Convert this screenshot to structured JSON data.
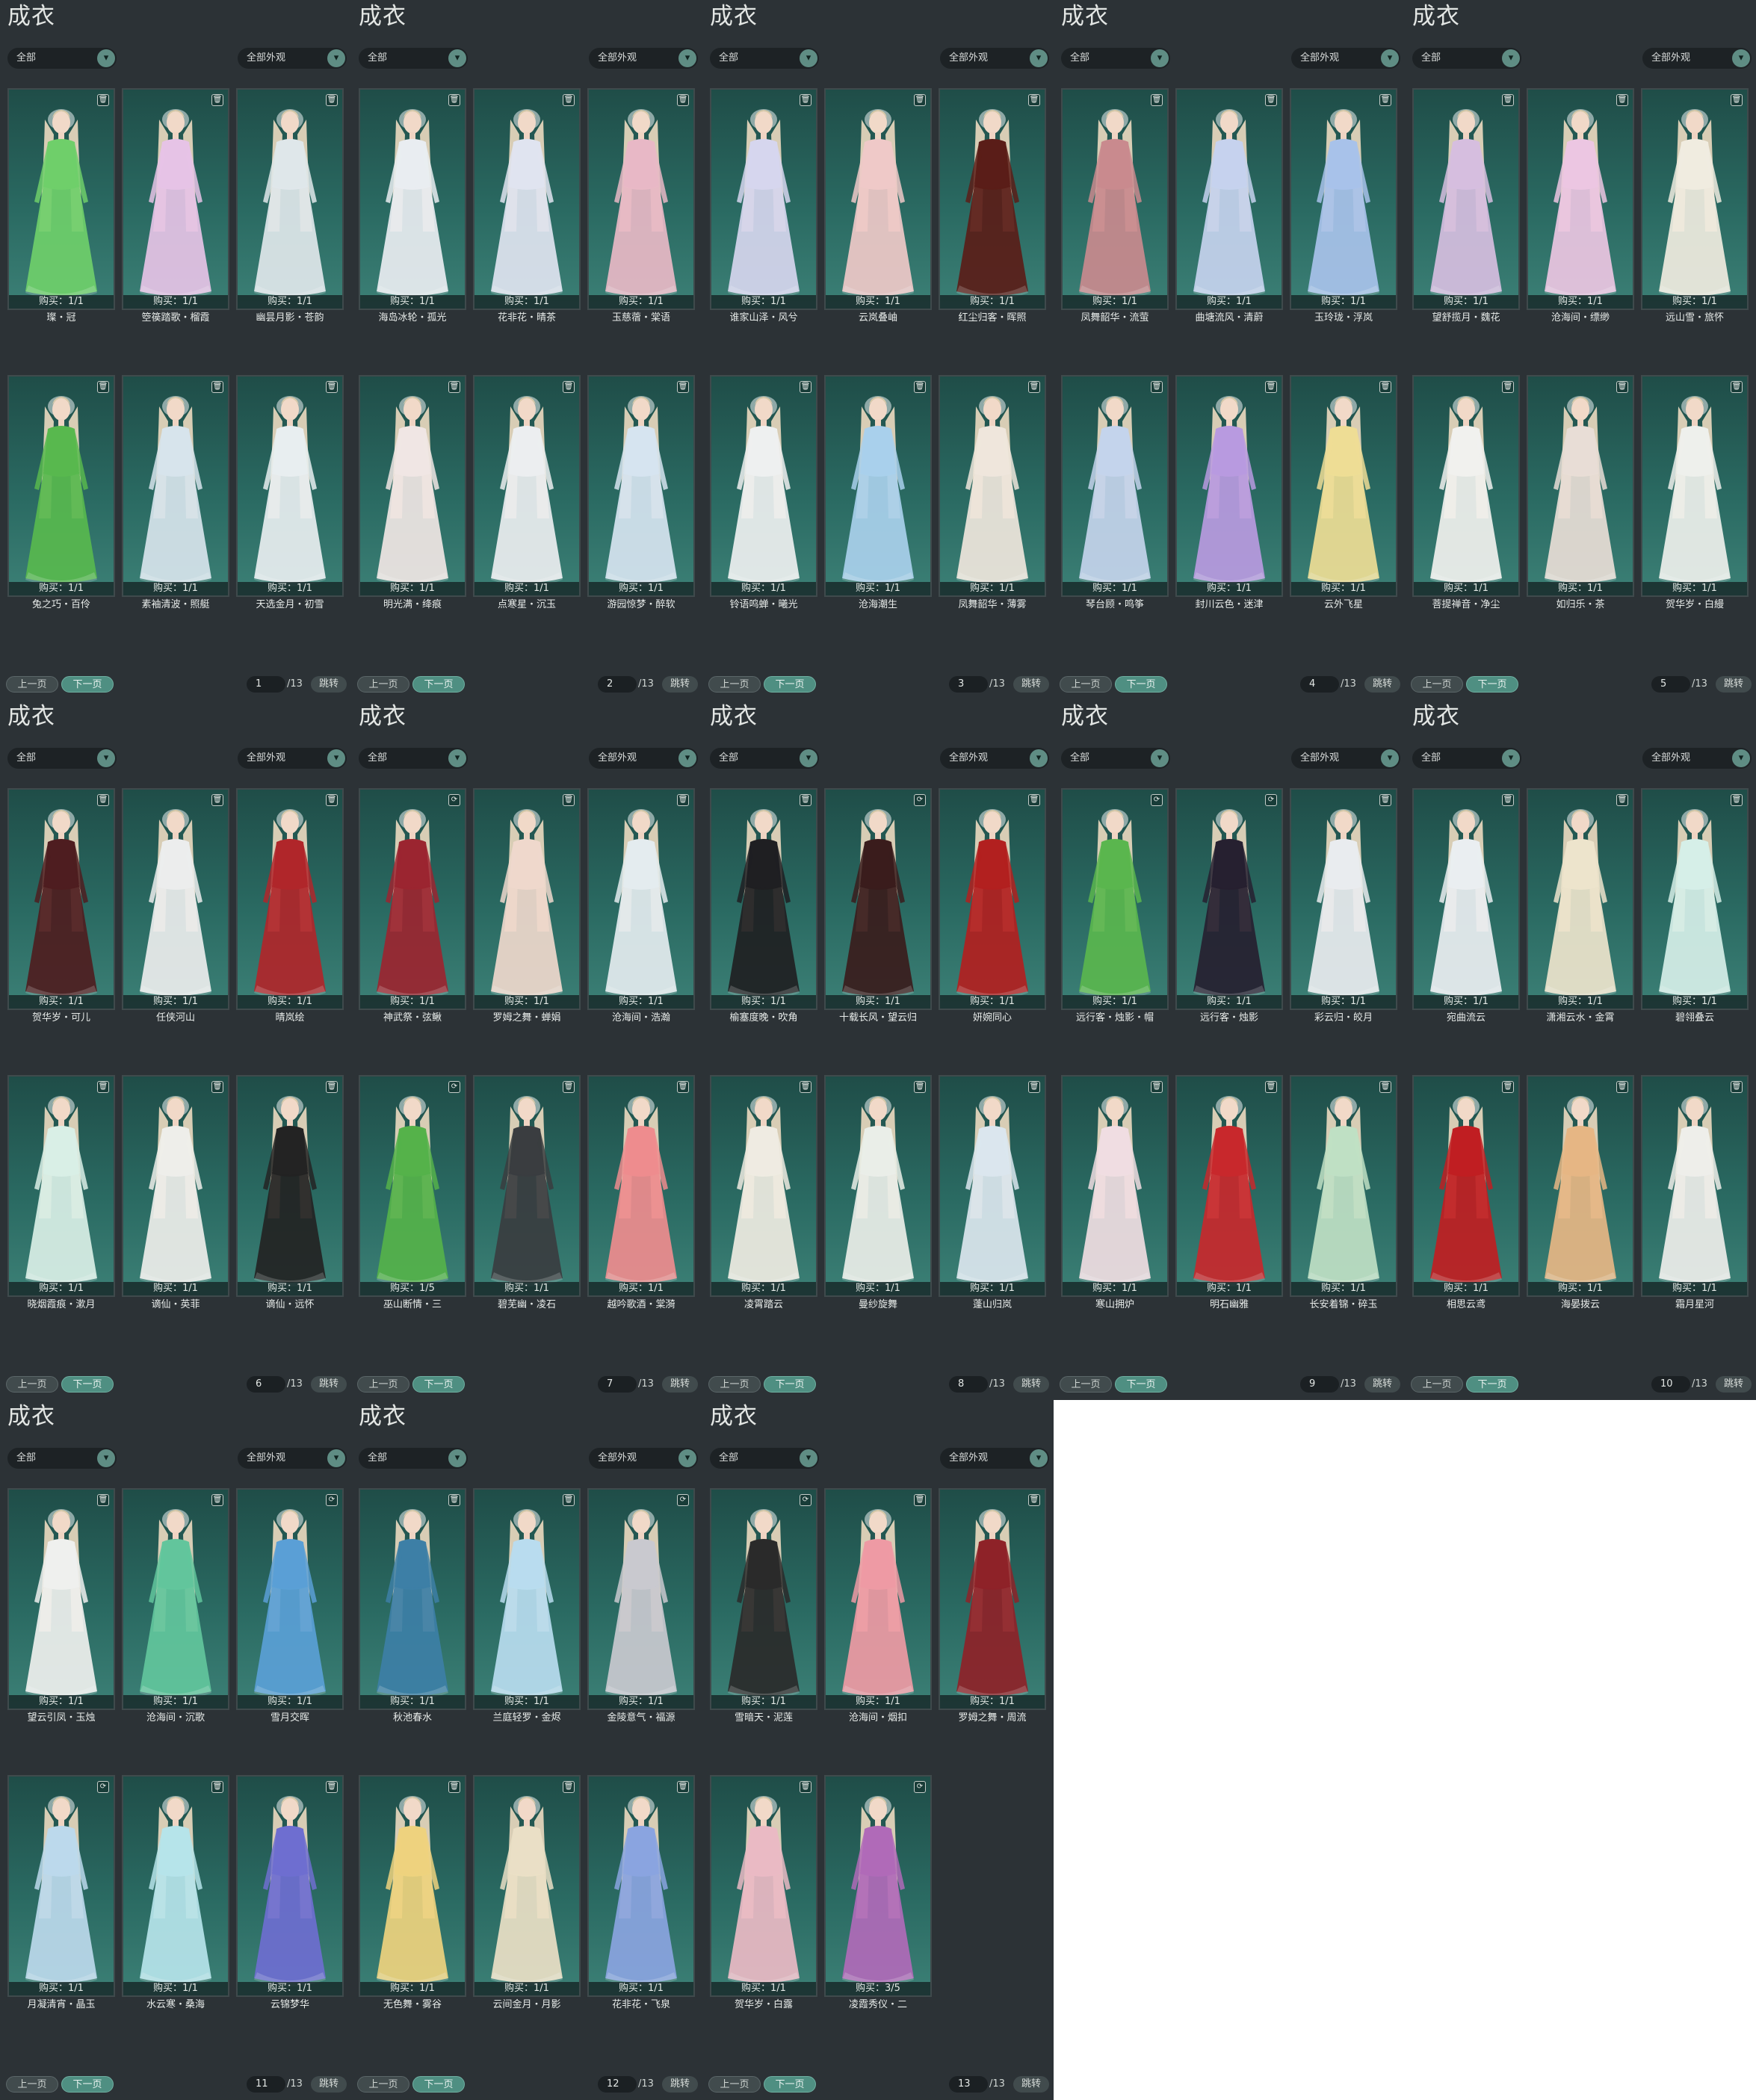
{
  "panel_title": "成衣",
  "filter_left": "全部",
  "filter_right": "全部外观",
  "prev_label": "上一页",
  "next_label": "下一页",
  "jump_label": "跳转",
  "total_pages": "/13",
  "colors": {
    "accent": "#5f8d84",
    "panel_bg": "#2c3236",
    "card_bg": "#2a6a62"
  },
  "icons": {
    "select_chevron": "chevron-down-icon",
    "trash": "trash-icon",
    "refresh": "refresh-icon"
  },
  "pages": [
    {
      "page": "1",
      "items": [
        {
          "name": "璨・冠",
          "buy": "购买：1/1",
          "icon": "trash",
          "dress": "#6fcf6a"
        },
        {
          "name": "箜篌踏歌・榴霞",
          "buy": "购买：1/1",
          "icon": "trash",
          "dress": "#e6c3e6"
        },
        {
          "name": "幽昙月影・苍韵",
          "buy": "购买：1/1",
          "icon": "trash",
          "dress": "#dfe7ea"
        },
        {
          "name": "兔之巧・百伶",
          "buy": "购买：1/1",
          "icon": "trash",
          "dress": "#58b84e"
        },
        {
          "name": "素袖清波・照艇",
          "buy": "购买：1/1",
          "icon": "trash",
          "dress": "#d7e4ec"
        },
        {
          "name": "天选金月・初雪",
          "buy": "购买：1/1",
          "icon": "trash",
          "dress": "#e8eef0"
        }
      ]
    },
    {
      "page": "2",
      "items": [
        {
          "name": "海岛冰轮・孤光",
          "buy": "购买：1/1",
          "icon": "trash",
          "dress": "#e9edf1"
        },
        {
          "name": "花非花・晴茶",
          "buy": "购买：1/1",
          "icon": "trash",
          "dress": "#e0e4f0"
        },
        {
          "name": "玉慈蓿・棠语",
          "buy": "购买：1/1",
          "icon": "trash",
          "dress": "#e8b8c6"
        },
        {
          "name": "明光满・绛痕",
          "buy": "购买：1/1",
          "icon": "trash",
          "dress": "#f0e6e4"
        },
        {
          "name": "点寒星・沉玉",
          "buy": "购买：1/1",
          "icon": "trash",
          "dress": "#eceef0"
        },
        {
          "name": "游园惊梦・醉软",
          "buy": "购买：1/1",
          "icon": "trash",
          "dress": "#d6e4f0"
        }
      ]
    },
    {
      "page": "3",
      "items": [
        {
          "name": "谁家山泽・风兮",
          "buy": "购买：1/1",
          "icon": "trash",
          "dress": "#d6d6ee"
        },
        {
          "name": "云岚叠岫",
          "buy": "购买：1/1",
          "icon": "trash",
          "dress": "#efc9c8"
        },
        {
          "name": "红尘归客・晖照",
          "buy": "购买：1/1",
          "icon": "trash",
          "dress": "#5a1d18"
        },
        {
          "name": "铃语鸣蝉・曦光",
          "buy": "购买：1/1",
          "icon": "trash",
          "dress": "#eef0f0"
        },
        {
          "name": "沧海潮生",
          "buy": "购买：1/1",
          "icon": "trash",
          "dress": "#a9d0ec"
        },
        {
          "name": "凤舞韶华・薄雾",
          "buy": "购买：1/1",
          "icon": "trash",
          "dress": "#efe6dc"
        }
      ]
    },
    {
      "page": "4",
      "items": [
        {
          "name": "凤舞韶华・流萤",
          "buy": "购买：1/1",
          "icon": "trash",
          "dress": "#c98a8e"
        },
        {
          "name": "曲塘流风・清蔚",
          "buy": "购买：1/1",
          "icon": "trash",
          "dress": "#c6d2ee"
        },
        {
          "name": "玉玲珑・浮岚",
          "buy": "购买：1/1",
          "icon": "trash",
          "dress": "#a8c2ea"
        },
        {
          "name": "琴台顾・鸣筝",
          "buy": "购买：1/1",
          "icon": "trash",
          "dress": "#c4d4ec"
        },
        {
          "name": "封川云色・迷津",
          "buy": "购买：1/1",
          "icon": "trash",
          "dress": "#b89ae0"
        },
        {
          "name": "云外飞星",
          "buy": "购买：1/1",
          "icon": "trash",
          "dress": "#eedd95"
        }
      ]
    },
    {
      "page": "5",
      "items": [
        {
          "name": "望舒揽月・魏花",
          "buy": "购买：1/1",
          "icon": "trash",
          "dress": "#d6bedf"
        },
        {
          "name": "沧海间・缥缈",
          "buy": "购买：1/1",
          "icon": "trash",
          "dress": "#ecc6e2"
        },
        {
          "name": "远山雪・旅怀",
          "buy": "购买：1/1",
          "icon": "trash",
          "dress": "#f0ece0"
        },
        {
          "name": "菩提禅音・净尘",
          "buy": "购买：1/1",
          "icon": "trash",
          "dress": "#f1f1ee"
        },
        {
          "name": "如归乐・茶",
          "buy": "购买：1/1",
          "icon": "trash",
          "dress": "#e8ddd6"
        },
        {
          "name": "贺华岁・白縵",
          "buy": "购买：1/1",
          "icon": "trash",
          "dress": "#eef0ec"
        }
      ]
    },
    {
      "page": "6",
      "items": [
        {
          "name": "贺华岁・可儿",
          "buy": "购买：1/1",
          "icon": "trash",
          "dress": "#4e1d20"
        },
        {
          "name": "任侠河山",
          "buy": "购买：1/1",
          "icon": "trash",
          "dress": "#eceded"
        },
        {
          "name": "晴岚绘",
          "buy": "购买：1/1",
          "icon": "trash",
          "dress": "#b0262a"
        },
        {
          "name": "晓烟霞痕・漱月",
          "buy": "购买：1/1",
          "icon": "trash",
          "dress": "#d9efe6"
        },
        {
          "name": "谪仙・英菲",
          "buy": "购买：1/1",
          "icon": "trash",
          "dress": "#eeeeea"
        },
        {
          "name": "谪仙・远怀",
          "buy": "购买：1/1",
          "icon": "trash",
          "dress": "#232323"
        }
      ]
    },
    {
      "page": "7",
      "items": [
        {
          "name": "神武祭・弦鳅",
          "buy": "购买：1/1",
          "icon": "refresh",
          "dress": "#9b2530"
        },
        {
          "name": "罗姆之舞・蝉娟",
          "buy": "购买：1/1",
          "icon": "trash",
          "dress": "#efd8cc"
        },
        {
          "name": "沧海间・浩瀚",
          "buy": "购买：1/1",
          "icon": "trash",
          "dress": "#e4ecef"
        },
        {
          "name": "巫山断情・三",
          "buy": "购买：1/5",
          "icon": "refresh",
          "dress": "#55b24a"
        },
        {
          "name": "碧芜幽・凌石",
          "buy": "购买：1/1",
          "icon": "trash",
          "dress": "#3a3d40"
        },
        {
          "name": "越吟歌酒・棠漪",
          "buy": "购买：1/1",
          "icon": "trash",
          "dress": "#ee8c8e"
        }
      ]
    },
    {
      "page": "8",
      "items": [
        {
          "name": "榆塞度晚・吹角",
          "buy": "购买：1/1",
          "icon": "trash",
          "dress": "#1f1f22"
        },
        {
          "name": "十载长风・望云归",
          "buy": "购买：1/1",
          "icon": "refresh",
          "dress": "#3a1c1c"
        },
        {
          "name": "妍婉同心",
          "buy": "购买：1/1",
          "icon": "trash",
          "dress": "#b2201f"
        },
        {
          "name": "凌霄踏云",
          "buy": "购买：1/1",
          "icon": "trash",
          "dress": "#efebe2"
        },
        {
          "name": "曼纱旋舞",
          "buy": "购买：1/1",
          "icon": "trash",
          "dress": "#eaeee8"
        },
        {
          "name": "蓬山归岚",
          "buy": "购买：1/1",
          "icon": "trash",
          "dress": "#dbe6ee"
        }
      ]
    },
    {
      "page": "9",
      "items": [
        {
          "name": "远行客・烛影・帽",
          "buy": "购买：1/1",
          "icon": "refresh",
          "dress": "#5ab64e"
        },
        {
          "name": "远行客・烛影",
          "buy": "购买：1/1",
          "icon": "refresh",
          "dress": "#262030"
        },
        {
          "name": "彩云归・皎月",
          "buy": "购买：1/1",
          "icon": "trash",
          "dress": "#e9ecef"
        },
        {
          "name": "寒山拥炉",
          "buy": "购买：1/1",
          "icon": "trash",
          "dress": "#f0dde2"
        },
        {
          "name": "明石幽雅",
          "buy": "购买：1/1",
          "icon": "trash",
          "dress": "#c8282c"
        },
        {
          "name": "长安着锦・碎玉",
          "buy": "购买：1/1",
          "icon": "trash",
          "dress": "#bfe0c4"
        }
      ]
    },
    {
      "page": "10",
      "items": [
        {
          "name": "宛曲流云",
          "buy": "购买：1/1",
          "icon": "trash",
          "dress": "#eaeef1"
        },
        {
          "name": "潇湘云水・金霄",
          "buy": "购买：1/1",
          "icon": "trash",
          "dress": "#ede4cc"
        },
        {
          "name": "碧翎叠云",
          "buy": "购买：1/1",
          "icon": "trash",
          "dress": "#d6efe8"
        },
        {
          "name": "相思云鸢",
          "buy": "购买：1/1",
          "icon": "trash",
          "dress": "#c01e22"
        },
        {
          "name": "海晏拨云",
          "buy": "购买：1/1",
          "icon": "trash",
          "dress": "#e6b684"
        },
        {
          "name": "霜月星河",
          "buy": "购买：1/1",
          "icon": "trash",
          "dress": "#eeeeea"
        }
      ]
    },
    {
      "page": "11",
      "items": [
        {
          "name": "望云引凤・玉烛",
          "buy": "购买：1/1",
          "icon": "trash",
          "dress": "#eff0ee"
        },
        {
          "name": "沧海间・沉歌",
          "buy": "购买：1/1",
          "icon": "trash",
          "dress": "#62c59c"
        },
        {
          "name": "雪月交晖",
          "buy": "购买：1/1",
          "icon": "refresh",
          "dress": "#5a9fd6"
        },
        {
          "name": "月凝清宵・晶玉",
          "buy": "购买：1/1",
          "icon": "refresh",
          "dress": "#bcd9ec"
        },
        {
          "name": "水云寒・桑海",
          "buy": "购买：1/1",
          "icon": "trash",
          "dress": "#b6e4ea"
        },
        {
          "name": "云锦梦华",
          "buy": "购买：1/1",
          "icon": "trash",
          "dress": "#6e6ed0"
        }
      ]
    },
    {
      "page": "12",
      "items": [
        {
          "name": "秋池春水",
          "buy": "购买：1/1",
          "icon": "trash",
          "dress": "#3d7fa6"
        },
        {
          "name": "兰庭轻罗・金烬",
          "buy": "购买：1/1",
          "icon": "trash",
          "dress": "#b9dcef"
        },
        {
          "name": "金陵意气・福源",
          "buy": "购买：1/1",
          "icon": "refresh",
          "dress": "#c9c9cf"
        },
        {
          "name": "无色舞・雾谷",
          "buy": "购买：1/1",
          "icon": "trash",
          "dress": "#eed27e"
        },
        {
          "name": "云间金月・月影",
          "buy": "购买：1/1",
          "icon": "trash",
          "dress": "#eadfc6"
        },
        {
          "name": "花非花・飞泉",
          "buy": "购买：1/1",
          "icon": "trash",
          "dress": "#8aa4e0"
        }
      ]
    },
    {
      "page": "13",
      "items": [
        {
          "name": "雪暗天・泥莲",
          "buy": "购买：1/1",
          "icon": "refresh",
          "dress": "#2a2a2a"
        },
        {
          "name": "沧海间・烟扣",
          "buy": "购买：1/1",
          "icon": "trash",
          "dress": "#ee9aa4"
        },
        {
          "name": "罗姆之舞・周流",
          "buy": "购买：1/1",
          "icon": "trash",
          "dress": "#8e2228"
        },
        {
          "name": "贺华岁・白露",
          "buy": "购买：1/1",
          "icon": "trash",
          "dress": "#eabac4"
        },
        {
          "name": "凌霞秀仪・二",
          "buy": "购买：3/5",
          "icon": "refresh",
          "dress": "#b06ab8"
        }
      ]
    }
  ]
}
